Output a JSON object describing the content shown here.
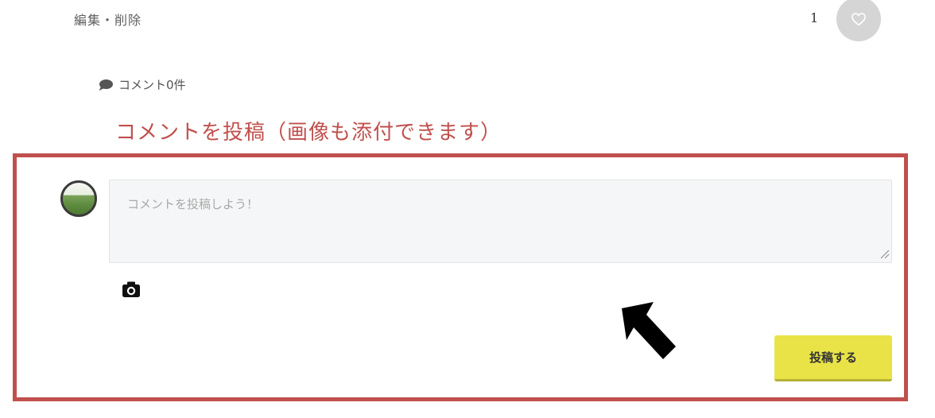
{
  "post_actions": {
    "edit_delete_label": "編集・削除",
    "like_count": "1",
    "like_icon": "heart-outline-icon"
  },
  "comments": {
    "count_label": "コメント0件",
    "count_icon": "speech-bubble-icon"
  },
  "annotation": {
    "title": "コメントを投稿（画像も添付できます）",
    "frame_color": "#c0504d"
  },
  "comment_form": {
    "avatar_icon": "user-avatar",
    "input_placeholder": "コメントを投稿しよう！",
    "input_value": "",
    "attach_image_icon": "camera-icon",
    "submit_label": "投稿する",
    "submit_color": "#e9e347"
  },
  "overlay": {
    "pointer_icon": "black-arrow-icon"
  }
}
